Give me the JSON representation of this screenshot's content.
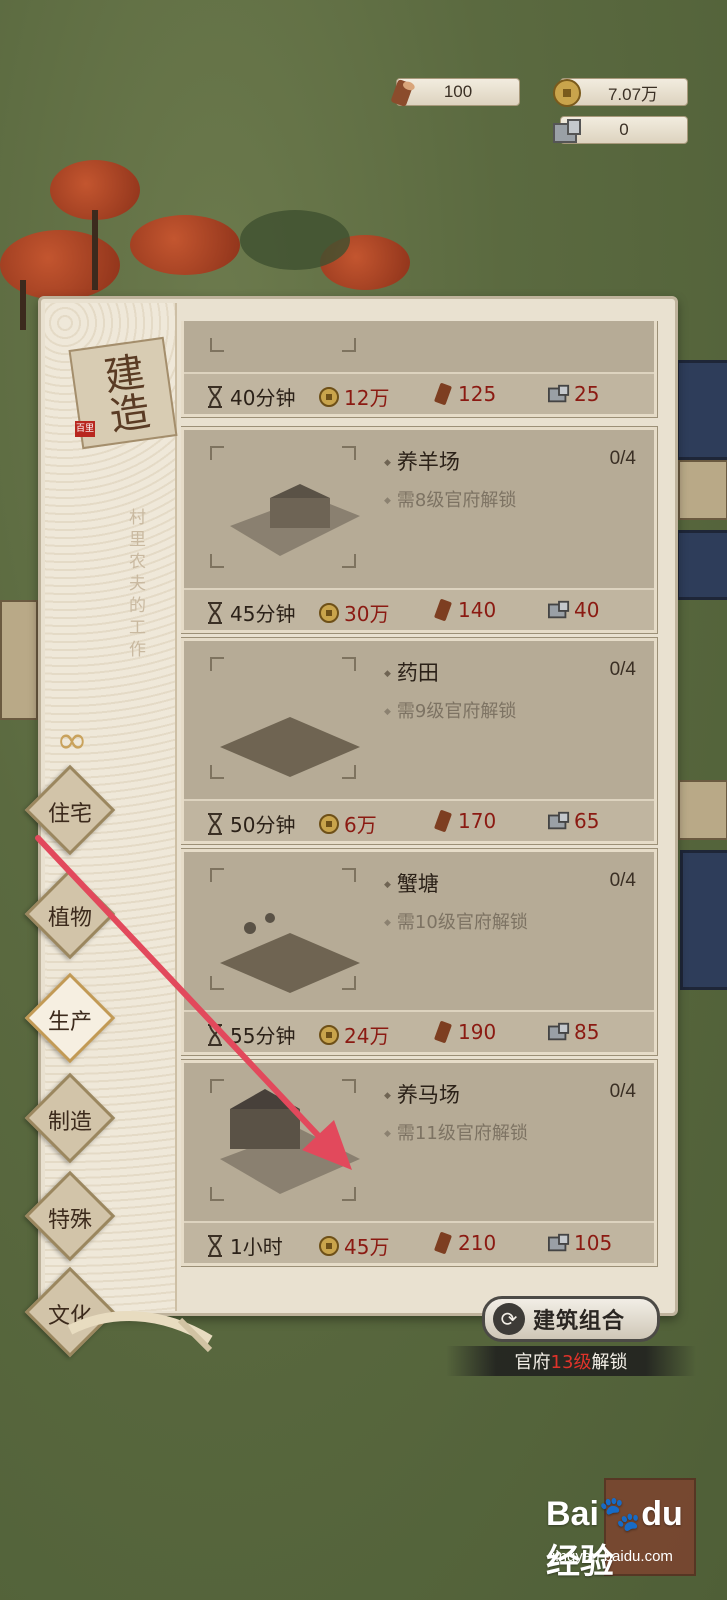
{
  "resources": {
    "wood": "100",
    "coins": "7.07万",
    "stone": "0"
  },
  "panel": {
    "title": "建造",
    "seal": "百里",
    "subtitle": "村里农夫的工作"
  },
  "buildings": [
    {
      "name": "",
      "count": "",
      "requirement": "",
      "time": "40分钟",
      "coins": "12万",
      "wood": "125",
      "stone": "25",
      "icon": "field-icon"
    },
    {
      "name": "养羊场",
      "count": "0/4",
      "requirement": "需8级官府解锁",
      "time": "45分钟",
      "coins": "30万",
      "wood": "140",
      "stone": "40",
      "icon": "sheep-farm-icon"
    },
    {
      "name": "药田",
      "count": "0/4",
      "requirement": "需9级官府解锁",
      "time": "50分钟",
      "coins": "6万",
      "wood": "170",
      "stone": "65",
      "icon": "herb-field-icon"
    },
    {
      "name": "蟹塘",
      "count": "0/4",
      "requirement": "需10级官府解锁",
      "time": "55分钟",
      "coins": "24万",
      "wood": "190",
      "stone": "85",
      "icon": "crab-pond-icon"
    },
    {
      "name": "养马场",
      "count": "0/4",
      "requirement": "需11级官府解锁",
      "time": "1小时",
      "coins": "45万",
      "wood": "210",
      "stone": "105",
      "icon": "horse-farm-icon"
    }
  ],
  "tabs": [
    {
      "label": "住宅",
      "active": false
    },
    {
      "label": "植物",
      "active": false
    },
    {
      "label": "生产",
      "active": true
    },
    {
      "label": "制造",
      "active": false
    },
    {
      "label": "特殊",
      "active": false
    },
    {
      "label": "文化",
      "active": false
    }
  ],
  "combo": {
    "label": "建筑组合",
    "unlock_prefix": "官府",
    "unlock_level": "13级",
    "unlock_suffix": "解锁"
  },
  "watermark": {
    "logo_a": "Bai",
    "logo_b": "du",
    "logo_c": "经验",
    "url": "jingyan.baidu.com"
  },
  "colors": {
    "cost_red": "#8b1a12",
    "arrow_red": "#e2495c",
    "active_tab": "#f6efe1"
  }
}
